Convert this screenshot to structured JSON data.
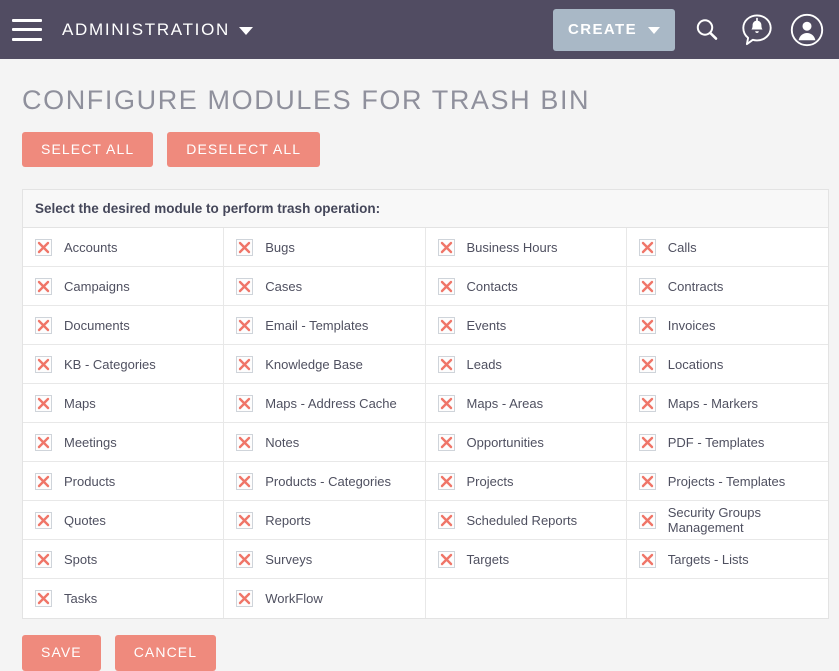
{
  "topbar": {
    "menu_icon": "hamburger-menu-icon",
    "module_label": "ADMINISTRATION",
    "create_label": "CREATE",
    "search_icon": "search-icon",
    "notification_icon": "notification-bell-icon",
    "user_icon": "user-avatar-icon",
    "background_color": "#514c62",
    "create_button_color": "#a9b8c6"
  },
  "page": {
    "title": "CONFIGURE MODULES FOR TRASH BIN",
    "select_all_label": "SELECT ALL",
    "deselect_all_label": "DESELECT ALL",
    "accent_color": "#ef8a7d",
    "background_color": "#f4f4f4"
  },
  "panel": {
    "header": "Select the desired module to perform trash operation:",
    "checkbox_state": "checked-x",
    "modules": [
      "Accounts",
      "Bugs",
      "Business Hours",
      "Calls",
      "Campaigns",
      "Cases",
      "Contacts",
      "Contracts",
      "Documents",
      "Email - Templates",
      "Events",
      "Invoices",
      "KB - Categories",
      "Knowledge Base",
      "Leads",
      "Locations",
      "Maps",
      "Maps - Address Cache",
      "Maps - Areas",
      "Maps - Markers",
      "Meetings",
      "Notes",
      "Opportunities",
      "PDF - Templates",
      "Products",
      "Products - Categories",
      "Projects",
      "Projects - Templates",
      "Quotes",
      "Reports",
      "Scheduled Reports",
      "Security Groups Management",
      "Spots",
      "Surveys",
      "Targets",
      "Targets - Lists",
      "Tasks",
      "WorkFlow"
    ]
  },
  "footer": {
    "save_label": "SAVE",
    "cancel_label": "CANCEL"
  }
}
